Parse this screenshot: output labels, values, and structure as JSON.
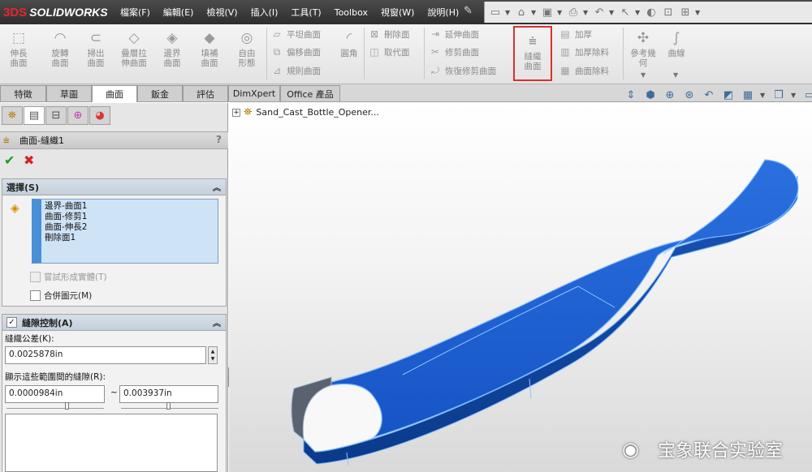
{
  "app": {
    "title": "SOLIDWORKS",
    "logo_mark": "3DS",
    "menu": [
      "檔案(F)",
      "編輯(E)",
      "檢視(V)",
      "插入(I)",
      "工具(T)",
      "Toolbox",
      "視窗(W)",
      "說明(H)"
    ],
    "accent_red": "#d9302e"
  },
  "ribbon": {
    "big_buttons": [
      {
        "label": "伸長曲面",
        "icon": "extruded-surface-icon"
      },
      {
        "label": "旋轉曲面",
        "icon": "revolved-surface-icon"
      },
      {
        "label": "掃出曲面",
        "icon": "swept-surface-icon"
      },
      {
        "label": "疊層拉伸曲面",
        "icon": "lofted-surface-icon"
      },
      {
        "label": "邊界曲面",
        "icon": "boundary-surface-icon"
      },
      {
        "label": "填補曲面",
        "icon": "filled-surface-icon"
      },
      {
        "label": "自由形態",
        "icon": "freeform-icon"
      }
    ],
    "col1": [
      "平坦曲面",
      "偏移曲面",
      "規則曲面"
    ],
    "fillet": "圓角",
    "col2": [
      "刪除面",
      "取代面"
    ],
    "col3": [
      "延伸曲面",
      "修剪曲面",
      "恢復修剪曲面"
    ],
    "knit": "縫織曲面",
    "col4": [
      "加厚",
      "加厚除料",
      "曲面除料"
    ],
    "ref_geometry": "參考幾何",
    "curves": "曲線"
  },
  "tabs": {
    "items": [
      "特徵",
      "草圖",
      "曲面",
      "鈑金",
      "評估",
      "DimXpert",
      "Office 產品"
    ],
    "active": "曲面"
  },
  "property_manager": {
    "title": "曲面-縫織1",
    "help": "?",
    "selections": {
      "title": "選擇(S)",
      "items": [
        "邊界-曲面1",
        "曲面-修剪1",
        "曲面-伸長2",
        "刪除面1"
      ],
      "try_solid": {
        "label": "嘗試形成實體(T)",
        "checked": false,
        "enabled": false
      },
      "merge_entities": {
        "label": "合併圖元(M)",
        "checked": false,
        "enabled": true
      }
    },
    "gap_control": {
      "title": "縫隙控制(A)",
      "checked": true,
      "tolerance_label": "縫織公差(K):",
      "tolerance_value": "0.0025878in",
      "range_label": "顯示這些範圍間的縫隙(R):",
      "range_min": "0.0000984in",
      "range_sep": "~",
      "range_max": "0.003937in"
    }
  },
  "viewport": {
    "tree_root": "Sand_Cast_Bottle_Opener...",
    "model_color": "#1f5fd0",
    "watermark": "宝象联合实验室"
  }
}
